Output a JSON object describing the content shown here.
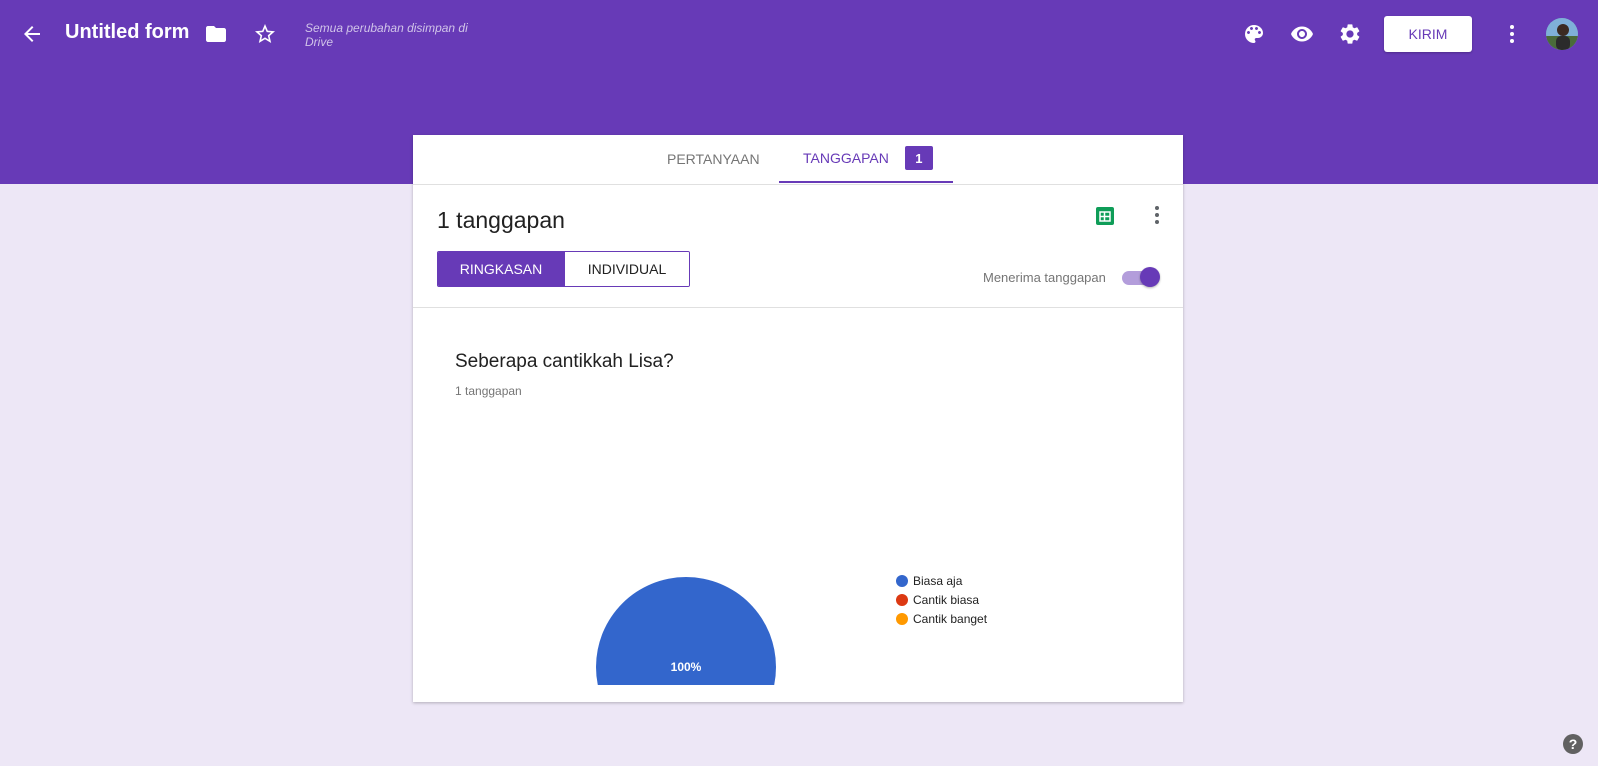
{
  "header": {
    "title": "Untitled form",
    "saved_status": "Semua perubahan disimpan di Drive",
    "send_label": "KIRIM",
    "icons": [
      "back-arrow-icon",
      "folder-icon",
      "star-icon",
      "palette-icon",
      "eye-icon",
      "gear-icon",
      "more-vert-icon"
    ]
  },
  "tabs": {
    "questions_label": "PERTANYAAN",
    "responses_label": "TANGGAPAN",
    "responses_count": "1"
  },
  "responses": {
    "count_title": "1 tanggapan",
    "summary_label": "RINGKASAN",
    "individual_label": "INDIVIDUAL",
    "accepting_label": "Menerima tanggapan",
    "accepting": true
  },
  "question": {
    "title": "Seberapa cantikkah Lisa?",
    "subtitle": "1 tanggapan"
  },
  "chart_data": {
    "type": "pie",
    "categories": [
      "Biasa aja",
      "Cantik biasa",
      "Cantik banget"
    ],
    "values": [
      100,
      0,
      0
    ],
    "colors": [
      "#3366cc",
      "#dc3912",
      "#ff9900"
    ],
    "slice_label": "100%",
    "legend_position": "right"
  },
  "colors": {
    "brand": "#673ab7",
    "background": "#ede7f6"
  },
  "help_label": "?"
}
